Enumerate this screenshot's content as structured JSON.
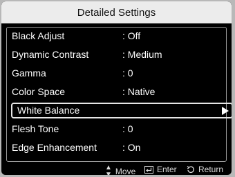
{
  "menu": {
    "title": "Detailed Settings",
    "items": [
      {
        "label": "Black Adjust",
        "value": ": Off"
      },
      {
        "label": "Dynamic Contrast",
        "value": ": Medium"
      },
      {
        "label": "Gamma",
        "value": ": 0"
      },
      {
        "label": "Color Space",
        "value": ": Native"
      },
      {
        "label": "White Balance",
        "value": ""
      },
      {
        "label": "Flesh Tone",
        "value": ": 0"
      },
      {
        "label": "Edge Enhancement",
        "value": ": On"
      }
    ],
    "selected_index": 4
  },
  "footer": {
    "move_label": "Move",
    "enter_label": "Enter",
    "return_label": "Return"
  },
  "icons": {
    "move": "up-down-arrows-icon",
    "enter": "enter-icon",
    "return": "return-icon",
    "submenu": "right-triangle-icon"
  }
}
